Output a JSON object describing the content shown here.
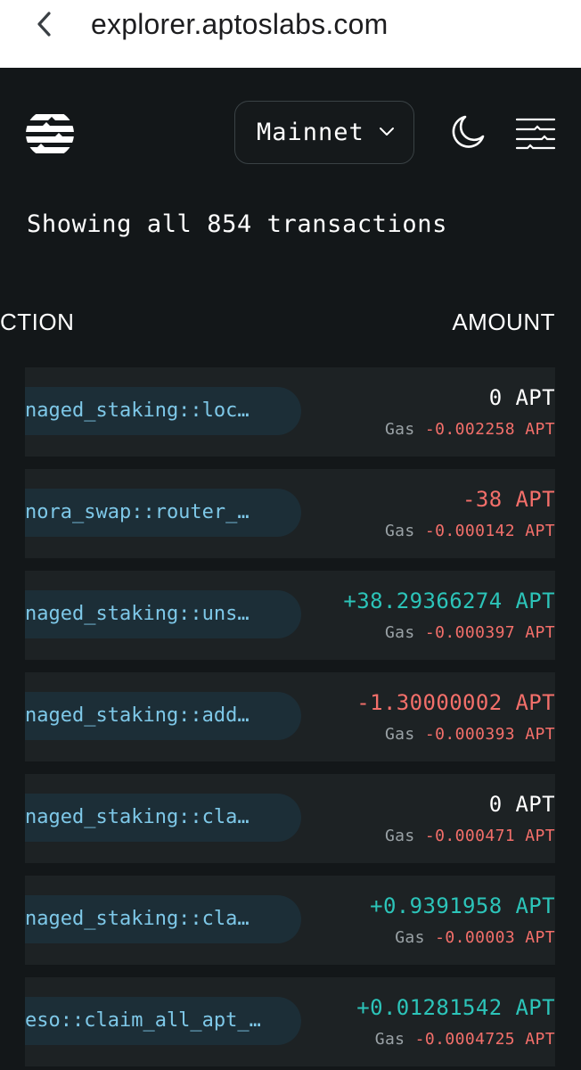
{
  "browser": {
    "url": "explorer.aptoslabs.com"
  },
  "header": {
    "network_selected": "Mainnet"
  },
  "summary": "Showing all 854 transactions",
  "table": {
    "columns": [
      "CTION",
      "AMOUNT"
    ],
    "rows": [
      {
        "function": "naged_staking::loc…",
        "amount": "0 APT",
        "amount_sign": "zero",
        "gas_label": "Gas",
        "gas": "-0.002258 APT"
      },
      {
        "function": "nora_swap::router_…",
        "amount": "-38 APT",
        "amount_sign": "neg",
        "gas_label": "Gas",
        "gas": "-0.000142 APT"
      },
      {
        "function": "naged_staking::uns…",
        "amount": "+38.29366274 APT",
        "amount_sign": "pos",
        "gas_label": "Gas",
        "gas": "-0.000397 APT"
      },
      {
        "function": "naged_staking::add…",
        "amount": "-1.30000002 APT",
        "amount_sign": "neg",
        "gas_label": "Gas",
        "gas": "-0.000393 APT"
      },
      {
        "function": "naged_staking::cla…",
        "amount": "0 APT",
        "amount_sign": "zero",
        "gas_label": "Gas",
        "gas": "-0.000471 APT"
      },
      {
        "function": "naged_staking::cla…",
        "amount": "+0.9391958 APT",
        "amount_sign": "pos",
        "gas_label": "Gas",
        "gas": "-0.00003 APT"
      },
      {
        "function": "eso::claim_all_apt_…",
        "amount": "+0.01281542 APT",
        "amount_sign": "pos",
        "gas_label": "Gas",
        "gas": "-0.0004725 APT"
      }
    ]
  },
  "colors": {
    "background": "#131719",
    "row": "#1d2224",
    "pill": "#1c2e37",
    "function_text": "#7ec8e8",
    "positive": "#2cc4b9",
    "negative": "#f36f6a"
  },
  "icons": [
    "back-chevron-icon",
    "aptos-logo-icon",
    "chevron-down-icon",
    "moon-icon",
    "menu-icon"
  ]
}
